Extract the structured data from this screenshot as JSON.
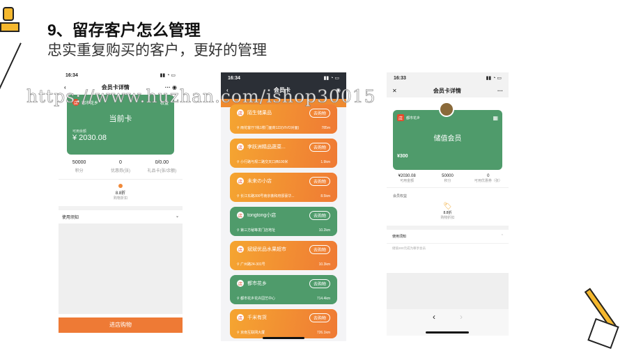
{
  "slide": {
    "title": "9、留存客户怎么管理",
    "subtitle": "忠实重复购买的客户，更好的管理"
  },
  "watermark": "https://www.huzhan.com/ishop30015",
  "phone1": {
    "time": "16:34",
    "nav_title": "会员卡详情",
    "brand": "都市花乡",
    "corner": "权益",
    "card_name": "当前卡",
    "balance_label": "可用余额",
    "balance": "¥ 2030.08",
    "stats": [
      {
        "value": "50000",
        "label": "积分"
      },
      {
        "value": "0",
        "label": "优惠券(张)"
      },
      {
        "value": "0/0.00",
        "label": "礼品卡(张/余额)"
      }
    ],
    "discount": "8.8折",
    "discount_label": "购物折扣",
    "notice": "使用须知",
    "button": "进店购物"
  },
  "phone2": {
    "time": "16:34",
    "nav_title": "会员卡",
    "go": "去购物",
    "stores": [
      {
        "name": "陌生储果品",
        "addr": "雨花客厅7栋1楼门面商122(VIVO对面)",
        "dist": "785m",
        "theme": "orange"
      },
      {
        "name": "李跃洲精品蔬菜...",
        "addr": "小行路与规二路交叉口西100米",
        "dist": "1.9km",
        "theme": "orange"
      },
      {
        "name": "未来の小店",
        "addr": "长江东路300号南京荟和府邸豪华...",
        "dist": "8.5km",
        "theme": "orange"
      },
      {
        "name": "tongtong小店",
        "addr": "第三方秘等发门店地址",
        "dist": "10.2km",
        "theme": "green"
      },
      {
        "name": "斌斌优品水果超市",
        "addr": "广州路24-301号",
        "dist": "10.3km",
        "theme": "orange"
      },
      {
        "name": "都市花乡",
        "addr": "都市花乡花卉园艺中心",
        "dist": "714.4km",
        "theme": "green"
      },
      {
        "name": "千米有货",
        "addr": "京南互联网大厦",
        "dist": "726.1km",
        "theme": "orange"
      }
    ]
  },
  "phone3": {
    "time": "16:33",
    "nav_title": "会员卡详情",
    "brand": "都市花乡",
    "card_name": "储值会员",
    "card_amount": "¥300",
    "stats": [
      {
        "value": "¥2030.08",
        "label": "可用金额"
      },
      {
        "value": "50000",
        "label": "积分"
      },
      {
        "value": "0",
        "label": "可用优惠券（张）"
      }
    ],
    "benefits": "会员权益",
    "discount": "8.8折",
    "discount_label": "购物折扣",
    "notice": "使用须知",
    "notice_text": "储值300元成为尊享会员"
  }
}
